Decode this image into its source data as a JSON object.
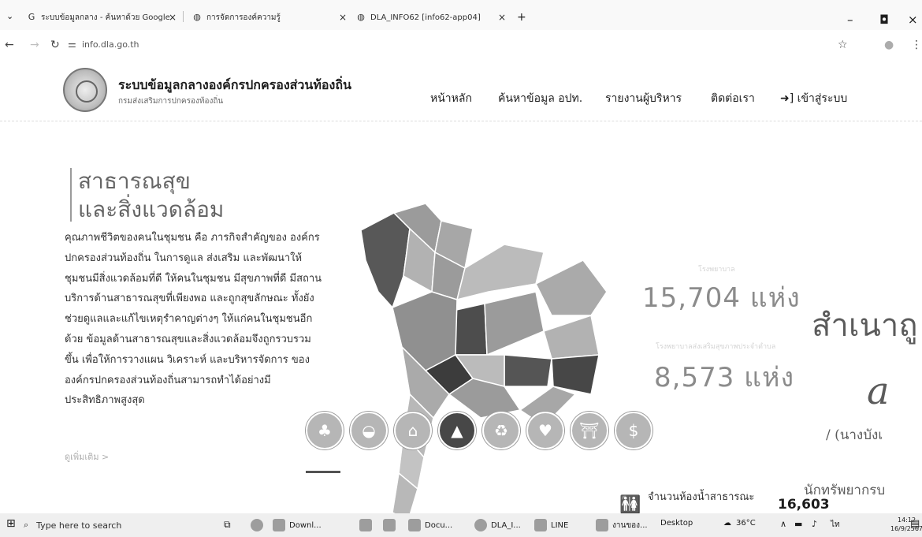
{
  "browser": {
    "tabs": [
      {
        "title": "ระบบข้อมูลกลาง - ค้นหาด้วย Google",
        "icon": "google-icon"
      },
      {
        "title": "การจัดการองค์ความรู้",
        "icon": "globe-icon"
      },
      {
        "title": "DLA_INFO62 [info62-app04]",
        "icon": "globe-icon"
      }
    ],
    "new_tab": "+",
    "url": "info.dla.go.th"
  },
  "site": {
    "title": "ระบบข้อมูลกลางองค์กรปกครองส่วนท้องถิ่น",
    "subtitle": "กรมส่งเสริมการปกครองท้องถิ่น",
    "menu": [
      "หน้าหลัก",
      "ค้นหาข้อมูล อปท.",
      "รายงานผู้บริหาร",
      "ติดต่อเรา",
      "เข้าสู่ระบบ"
    ]
  },
  "main": {
    "heading_line1": "สาธารณสุข",
    "heading_line2": "และสิ่งแวดล้อม",
    "description": "คุณภาพชีวิตของคนในชุมชน คือ ภารกิจสำคัญของ องค์กรปกครองส่วนท้องถิ่น ในการดูแล ส่งเสริม และพัฒนาให้ชุมชนมีสิ่งแวดล้อมที่ดี ให้คนในชุมชน มีสุขภาพที่ดี มีสถานบริการด้านสาธารณสุขที่เพียงพอ และถูกสุขลักษณะ ทั้งยังช่วยดูแลและแก้ไขเหตุรำคาญต่างๆ ให้แก่คนในชุมชนอีกด้วย ข้อมูลด้านสาธารณสุขและสิ่งแวดล้อมจึงถูกรวบรวมขึ้น เพื่อให้การวางแผน วิเคราะห์ และบริหารจัดการ ขององค์กรปกครองส่วนท้องถิ่นสามารถทำได้อย่างมีประสิทธิภาพสูงสุด",
    "more_link": "ดูเพิ่มเติม >",
    "stat1_label": "โรงพยาบาล",
    "stat1_value": "15,704 แห่ง",
    "stat2_label": "โรงพยาบาลส่งเสริมสุขภาพประจำตำบล",
    "stat2_value": "8,573 แห่ง",
    "toilet_label": "จำนวนห้องน้ำสาธารณะ",
    "toilet_count": "16,603",
    "category_icons": [
      "tree-icon",
      "hat-icon",
      "house-icon",
      "road-icon",
      "recycle-icon",
      "heart-icon",
      "temple-icon",
      "money-icon"
    ]
  },
  "stamp": {
    "line1": "สำเนาถู",
    "line2": "/ (นางบังเ",
    "line3": "นักทรัพยากรบ"
  },
  "taskbar": {
    "search_placeholder": "Type here to search",
    "items": [
      "Downl...",
      "Docu...",
      "DLA_I...",
      "LINE",
      "งานของ...",
      "Desktop"
    ],
    "temperature": "36°C",
    "time": "14:12",
    "date": "16/9/2567"
  }
}
